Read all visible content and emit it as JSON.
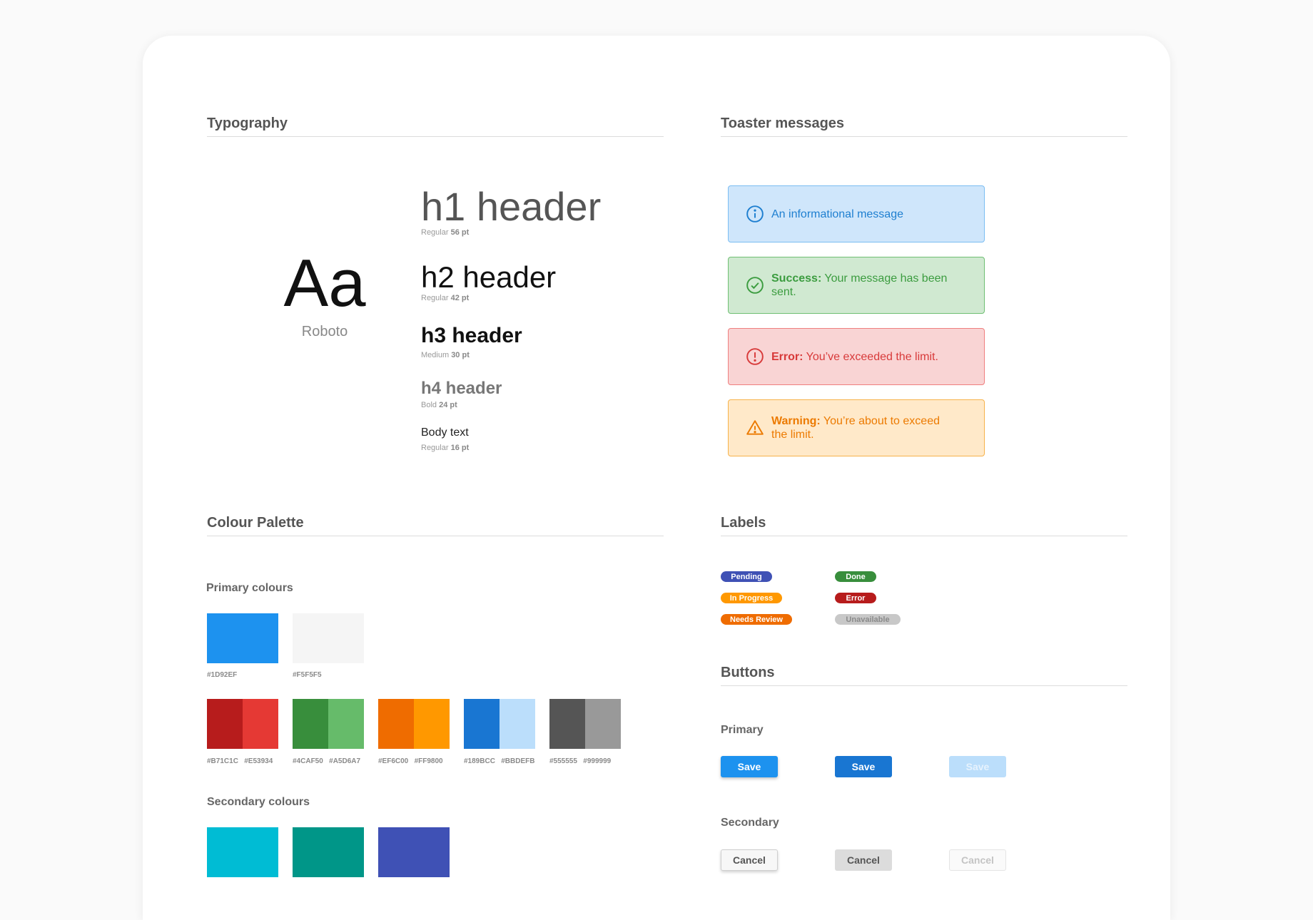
{
  "typography": {
    "title": "Typography",
    "sample": "Aa",
    "font_name": "Roboto",
    "styles": [
      {
        "text": "h1 header",
        "weight": "Regular",
        "size": "56 pt"
      },
      {
        "text": "h2 header",
        "weight": "Regular",
        "size": "42 pt"
      },
      {
        "text": "h3 header",
        "weight": "Medium",
        "size": "30 pt"
      },
      {
        "text": "h4 header",
        "weight": "Bold",
        "size": "24 pt"
      },
      {
        "text": "Body text",
        "weight": "Regular",
        "size": "16 pt"
      }
    ]
  },
  "toasts": {
    "title": "Toaster messages",
    "items": [
      {
        "type": "info",
        "icon": "info-icon",
        "prefix": "",
        "message": "An informational message"
      },
      {
        "type": "success",
        "icon": "check-circle-icon",
        "prefix": "Success:",
        "message": " Your message has been sent."
      },
      {
        "type": "error",
        "icon": "error-circle-icon",
        "prefix": "Error:",
        "message": " You’ve exceeded the limit."
      },
      {
        "type": "warning",
        "icon": "warning-triangle-icon",
        "prefix": "Warning:",
        "message": " You’re about to exceed the limit."
      }
    ]
  },
  "palette": {
    "title": "Colour Palette",
    "primary_title": "Primary colours",
    "primary": [
      {
        "colors": [
          "#1D92EF"
        ],
        "label": "#1D92EF"
      },
      {
        "colors": [
          "#F5F5F5"
        ],
        "label": "#F5F5F5"
      }
    ],
    "pairs": [
      {
        "colors": [
          "#B71C1C",
          "#E53934"
        ],
        "label": "#B71C1C   #E53934"
      },
      {
        "colors": [
          "#388E3C",
          "#66BB6A"
        ],
        "label": "#4CAF50   #A5D6A7"
      },
      {
        "colors": [
          "#EF6C00",
          "#FF9800"
        ],
        "label": "#EF6C00   #FF9800"
      },
      {
        "colors": [
          "#1976D2",
          "#BBDEFB"
        ],
        "label": "#189BCC   #BBDEFB"
      },
      {
        "colors": [
          "#555555",
          "#999999"
        ],
        "label": "#555555   #999999"
      }
    ],
    "secondary_title": "Secondary colours",
    "secondary": [
      "#00BCD4",
      "#009688",
      "#3F51B5"
    ]
  },
  "labels": {
    "title": "Labels",
    "items": [
      {
        "text": "Pending",
        "color": "#3F51B5",
        "text_color": "#ffffff"
      },
      {
        "text": "Done",
        "color": "#388E3C",
        "text_color": "#ffffff"
      },
      {
        "text": "In Progress",
        "color": "#FF9800",
        "text_color": "#ffffff"
      },
      {
        "text": "Error",
        "color": "#B71C1C",
        "text_color": "#ffffff"
      },
      {
        "text": "Needs Review",
        "color": "#EF6C00",
        "text_color": "#ffffff"
      },
      {
        "text": "Unavailable",
        "color": "#C8C8C8",
        "text_color": "#8a8a8a"
      }
    ]
  },
  "buttons": {
    "title": "Buttons",
    "primary_title": "Primary",
    "secondary_title": "Secondary",
    "primary": [
      {
        "text": "Save",
        "state": "default"
      },
      {
        "text": "Save",
        "state": "hover"
      },
      {
        "text": "Save",
        "state": "disabled"
      }
    ],
    "secondary": [
      {
        "text": "Cancel",
        "state": "default"
      },
      {
        "text": "Cancel",
        "state": "hover"
      },
      {
        "text": "Cancel",
        "state": "disabled"
      }
    ]
  },
  "colors": {
    "primary_blue": "#1D92EF",
    "primary_blue_dark": "#1976D2",
    "primary_blue_disabled": "#BBDEFB"
  }
}
